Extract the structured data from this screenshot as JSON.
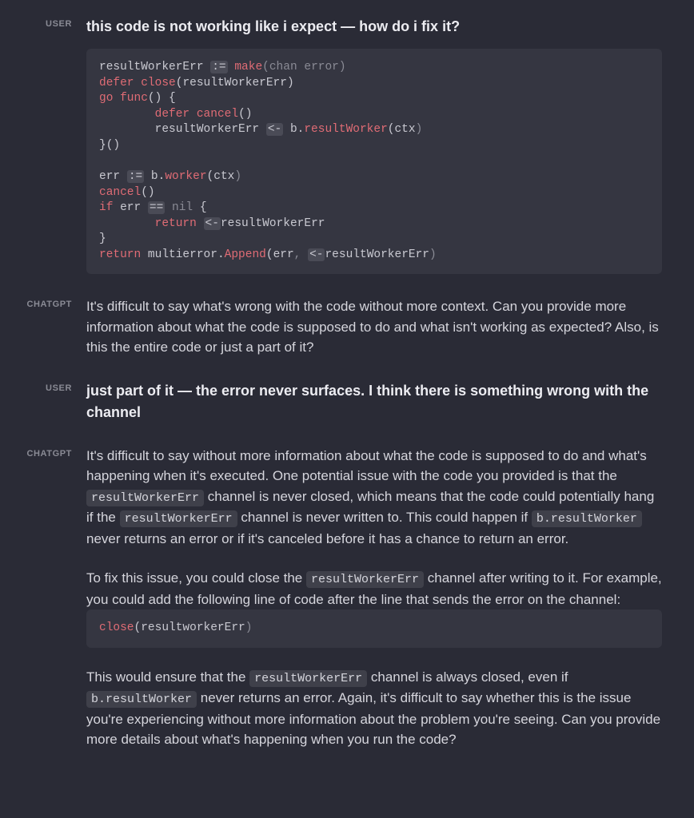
{
  "messages": [
    {
      "role": "USER",
      "text": "this code is not working like i expect — how do i fix it?",
      "code_tokens": [
        {
          "t": "resultWorkerErr ",
          "c": "k-lite"
        },
        {
          "t": ":=",
          "c": "op-bg k-lite"
        },
        {
          "t": " ",
          "c": "k-lite"
        },
        {
          "t": "make",
          "c": "k-red"
        },
        {
          "t": "(",
          "c": "k-grey"
        },
        {
          "t": "chan",
          "c": "k-grey"
        },
        {
          "t": " ",
          "c": ""
        },
        {
          "t": "error",
          "c": "k-grey"
        },
        {
          "t": ")",
          "c": "k-grey"
        },
        {
          "t": "\n",
          "c": ""
        },
        {
          "t": "defer",
          "c": "k-red"
        },
        {
          "t": " ",
          "c": ""
        },
        {
          "t": "close",
          "c": "k-red"
        },
        {
          "t": "(",
          "c": "k-lite"
        },
        {
          "t": "resultWorkerErr",
          "c": "k-lite"
        },
        {
          "t": ")",
          "c": "k-lite"
        },
        {
          "t": "\n",
          "c": ""
        },
        {
          "t": "go",
          "c": "k-red"
        },
        {
          "t": " ",
          "c": ""
        },
        {
          "t": "func",
          "c": "k-red"
        },
        {
          "t": "() {",
          "c": "k-lite"
        },
        {
          "t": "\n",
          "c": ""
        },
        {
          "t": "        ",
          "c": ""
        },
        {
          "t": "defer",
          "c": "k-red"
        },
        {
          "t": " ",
          "c": ""
        },
        {
          "t": "cancel",
          "c": "k-red"
        },
        {
          "t": "()",
          "c": "k-lite"
        },
        {
          "t": "\n",
          "c": ""
        },
        {
          "t": "        resultWorkerErr ",
          "c": "k-lite"
        },
        {
          "t": "<-",
          "c": "op-bg k-lite"
        },
        {
          "t": " b",
          "c": "k-lite"
        },
        {
          "t": ".",
          "c": "k-lite"
        },
        {
          "t": "resultWorker",
          "c": "k-red"
        },
        {
          "t": "(",
          "c": "k-lite"
        },
        {
          "t": "ctx",
          "c": "k-lite"
        },
        {
          "t": ")",
          "c": "k-grey"
        },
        {
          "t": "\n",
          "c": ""
        },
        {
          "t": "}()",
          "c": "k-lite"
        },
        {
          "t": "\n",
          "c": ""
        },
        {
          "t": "\n",
          "c": ""
        },
        {
          "t": "err ",
          "c": "k-lite"
        },
        {
          "t": ":=",
          "c": "op-bg k-lite"
        },
        {
          "t": " b",
          "c": "k-lite"
        },
        {
          "t": ".",
          "c": "k-lite"
        },
        {
          "t": "worker",
          "c": "k-red"
        },
        {
          "t": "(",
          "c": "k-lite"
        },
        {
          "t": "ctx",
          "c": "k-lite"
        },
        {
          "t": ")",
          "c": "k-grey"
        },
        {
          "t": "\n",
          "c": ""
        },
        {
          "t": "cancel",
          "c": "k-red"
        },
        {
          "t": "()",
          "c": "k-lite"
        },
        {
          "t": "\n",
          "c": ""
        },
        {
          "t": "if",
          "c": "k-red"
        },
        {
          "t": " err ",
          "c": "k-lite"
        },
        {
          "t": "==",
          "c": "op-bg k-lite"
        },
        {
          "t": " ",
          "c": ""
        },
        {
          "t": "nil",
          "c": "k-grey"
        },
        {
          "t": " {",
          "c": "k-lite"
        },
        {
          "t": "\n",
          "c": ""
        },
        {
          "t": "        ",
          "c": ""
        },
        {
          "t": "return",
          "c": "k-red"
        },
        {
          "t": " ",
          "c": ""
        },
        {
          "t": "<-",
          "c": "op-bg k-lite"
        },
        {
          "t": "resultWorkerErr",
          "c": "k-lite"
        },
        {
          "t": "\n",
          "c": ""
        },
        {
          "t": "}",
          "c": "k-lite"
        },
        {
          "t": "\n",
          "c": ""
        },
        {
          "t": "return",
          "c": "k-red"
        },
        {
          "t": " multierror",
          "c": "k-lite"
        },
        {
          "t": ".",
          "c": "k-lite"
        },
        {
          "t": "Append",
          "c": "k-red"
        },
        {
          "t": "(",
          "c": "k-lite"
        },
        {
          "t": "err",
          "c": "k-lite"
        },
        {
          "t": ",",
          "c": "k-grey"
        },
        {
          "t": " ",
          "c": ""
        },
        {
          "t": "<-",
          "c": "op-bg k-lite"
        },
        {
          "t": "resultWorkerErr",
          "c": "k-lite"
        },
        {
          "t": ")",
          "c": "k-grey"
        }
      ]
    },
    {
      "role": "CHATGPT",
      "text": "It's difficult to say what's wrong with the code without more context. Can you provide more information about what the code is supposed to do and what isn't working as expected? Also, is this the entire code or just a part of it?"
    },
    {
      "role": "USER",
      "text": "just part of it — the error never surfaces. I think there is something wrong with the channel"
    },
    {
      "role": "CHATGPT",
      "paragraphs": [
        {
          "parts": [
            {
              "t": "It's difficult to say without more information about what the code is supposed to do and what's happening when it's executed. One potential issue with the code you provided is that the "
            },
            {
              "t": "resultWorkerErr",
              "code": true
            },
            {
              "t": " channel is never closed, which means that the code could potentially hang if the "
            },
            {
              "t": "resultWorkerErr",
              "code": true
            },
            {
              "t": " channel is never written to. This could happen if "
            },
            {
              "t": "b.resultWorker",
              "code": true
            },
            {
              "t": " never returns an error or if it's canceled before it has a chance to return an error."
            }
          ]
        },
        {
          "parts": [
            {
              "t": "To fix this issue, you could close the "
            },
            {
              "t": "resultWorkerErr",
              "code": true
            },
            {
              "t": " channel after writing to it. For example, you could add the following line of code after the line that sends the error on the channel:"
            }
          ]
        }
      ],
      "code_tokens": [
        {
          "t": "close",
          "c": "k-red"
        },
        {
          "t": "(",
          "c": "k-lite"
        },
        {
          "t": "resultworkerErr",
          "c": "k-lite"
        },
        {
          "t": ")",
          "c": "k-grey"
        }
      ],
      "paragraphs_after": [
        {
          "parts": [
            {
              "t": "This would ensure that the "
            },
            {
              "t": "resultWorkerErr",
              "code": true
            },
            {
              "t": " channel is always closed, even if "
            },
            {
              "t": "b.resultWorker",
              "code": true
            },
            {
              "t": " never returns an error. Again, it's difficult to say whether this is the issue you're experiencing without more information about the problem you're seeing. Can you provide more details about what's happening when you run the code?"
            }
          ]
        }
      ]
    }
  ]
}
